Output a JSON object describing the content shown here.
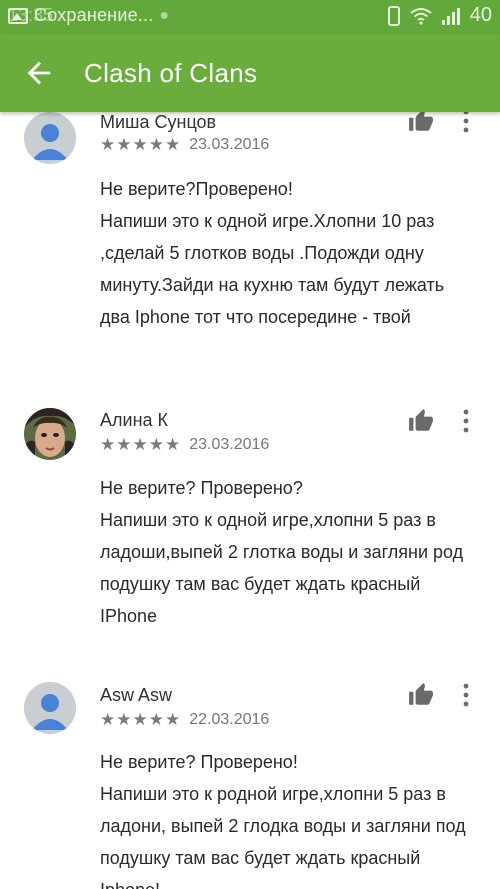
{
  "status_bar": {
    "time": "13:35",
    "notification": "Сохранение...",
    "battery": "40"
  },
  "app_bar": {
    "title": "Clash of Clans"
  },
  "colors": {
    "accent": "#6bad3c",
    "status_bar": "#63a83a",
    "stars": "#7b7b7b"
  },
  "icons": {
    "back": "arrow-back-icon",
    "like": "thumbs-up-icon",
    "more": "more-vert-icon",
    "avatar_default": "person-icon"
  },
  "reviews": [
    {
      "author": "Миша Сунцов",
      "stars": "★★★★★",
      "rating": 5,
      "date": "23.03.2016",
      "lines": [
        "Не верите?Проверено!",
        "Напиши это к одной игре.Хлопни 10 раз ,сделай 5 глотков воды .Подожди одну минуту.Зайди на кухню там будут лежать два Iphone тот что посередине - твой"
      ]
    },
    {
      "author": "Алина К",
      "stars": "★★★★★",
      "rating": 5,
      "date": "23.03.2016",
      "lines": [
        "Не верите? Проверено?",
        "Напиши это к одной игре,хлопни 5 раз в ладоши,выпей 2 глотка воды и загляни род подушку там вас будет ждать красный IPhone"
      ]
    },
    {
      "author": "Asw Asw",
      "stars": "★★★★★",
      "rating": 5,
      "date": "22.03.2016",
      "lines": [
        "Не верите? Проверено!",
        "Напиши это к родной игре,хлопни 5 раз в ладони, выпей 2 глодка воды и загляни под подушку там вас будет ждать красный Iphone!"
      ]
    }
  ]
}
